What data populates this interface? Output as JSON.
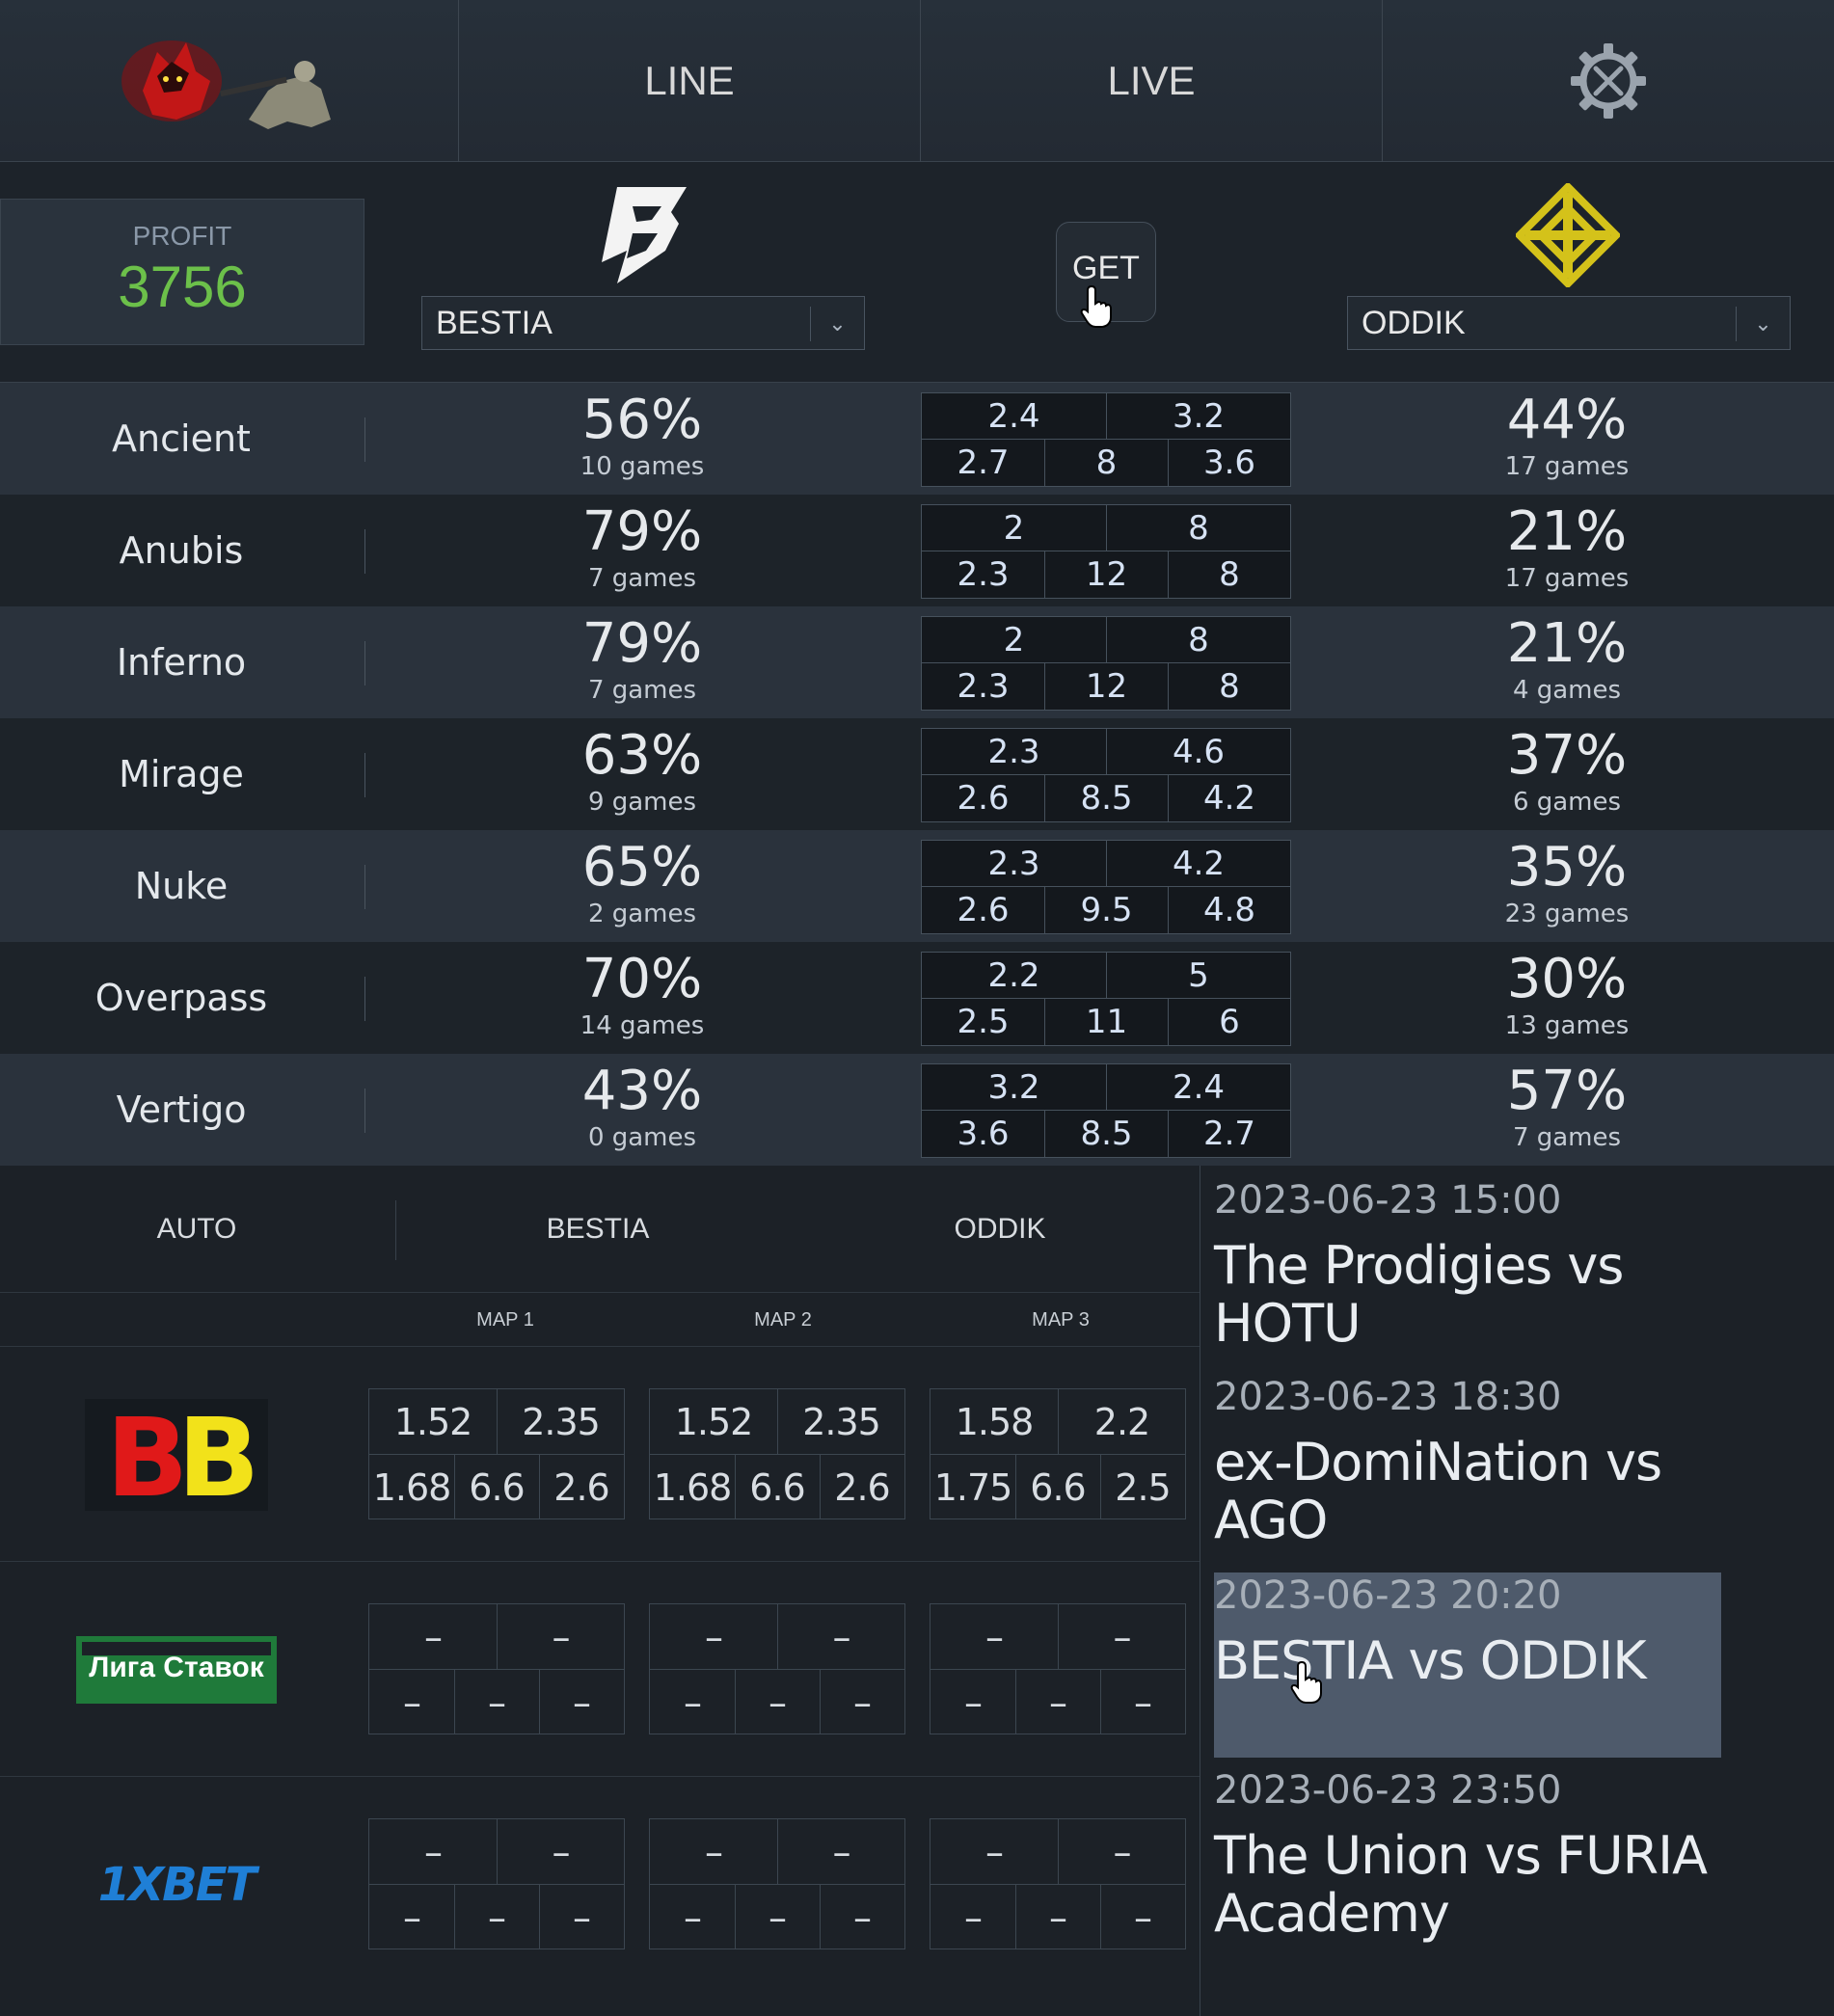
{
  "nav": {
    "tabs": [
      "LINE",
      "LIVE"
    ],
    "settings_icon": "gear-tools-icon"
  },
  "profit": {
    "label": "PROFIT",
    "value": "3756",
    "value_color": "#6cc04a"
  },
  "teams": {
    "a": {
      "name": "BESTIA",
      "logo": "bestia-logo"
    },
    "b": {
      "name": "ODDIK",
      "logo": "oddik-logo",
      "logo_color": "#d4c21a"
    }
  },
  "get_label": "GET",
  "maps": [
    {
      "name": "Ancient",
      "pct_a": "56%",
      "games_a": "10 games",
      "pct_b": "44%",
      "games_b": "17 games",
      "odds_top": [
        "2.4",
        "3.2"
      ],
      "odds_bottom": [
        "2.7",
        "8",
        "3.6"
      ]
    },
    {
      "name": "Anubis",
      "pct_a": "79%",
      "games_a": "7 games",
      "pct_b": "21%",
      "games_b": "17 games",
      "odds_top": [
        "2",
        "8"
      ],
      "odds_bottom": [
        "2.3",
        "12",
        "8"
      ]
    },
    {
      "name": "Inferno",
      "pct_a": "79%",
      "games_a": "7 games",
      "pct_b": "21%",
      "games_b": "4 games",
      "odds_top": [
        "2",
        "8"
      ],
      "odds_bottom": [
        "2.3",
        "12",
        "8"
      ]
    },
    {
      "name": "Mirage",
      "pct_a": "63%",
      "games_a": "9 games",
      "pct_b": "37%",
      "games_b": "6 games",
      "odds_top": [
        "2.3",
        "4.6"
      ],
      "odds_bottom": [
        "2.6",
        "8.5",
        "4.2"
      ]
    },
    {
      "name": "Nuke",
      "pct_a": "65%",
      "games_a": "2 games",
      "pct_b": "35%",
      "games_b": "23 games",
      "odds_top": [
        "2.3",
        "4.2"
      ],
      "odds_bottom": [
        "2.6",
        "9.5",
        "4.8"
      ]
    },
    {
      "name": "Overpass",
      "pct_a": "70%",
      "games_a": "14 games",
      "pct_b": "30%",
      "games_b": "13 games",
      "odds_top": [
        "2.2",
        "5"
      ],
      "odds_bottom": [
        "2.5",
        "11",
        "6"
      ]
    },
    {
      "name": "Vertigo",
      "pct_a": "43%",
      "games_a": "0 games",
      "pct_b": "57%",
      "games_b": "7 games",
      "odds_top": [
        "3.2",
        "2.4"
      ],
      "odds_bottom": [
        "3.6",
        "8.5",
        "2.7"
      ]
    }
  ],
  "bookmaker_section": {
    "auto_label": "AUTO",
    "team_a": "BESTIA",
    "team_b": "ODDIK",
    "map_headers": [
      "MAP 1",
      "MAP 2",
      "MAP 3"
    ],
    "rows": [
      {
        "bookmaker": "BB",
        "logo_colors": [
          "#e01919",
          "#f2e21a"
        ],
        "maps": [
          {
            "top": [
              "1.52",
              "2.35"
            ],
            "bottom": [
              "1.68",
              "6.6",
              "2.6"
            ]
          },
          {
            "top": [
              "1.52",
              "2.35"
            ],
            "bottom": [
              "1.68",
              "6.6",
              "2.6"
            ]
          },
          {
            "top": [
              "1.58",
              "2.2"
            ],
            "bottom": [
              "1.75",
              "6.6",
              "2.5"
            ]
          }
        ]
      },
      {
        "bookmaker": "Лига Ставок",
        "logo_colors": [
          "#1f7a3a",
          "#ffffff"
        ],
        "maps": [
          {
            "top": [
              "–",
              "–"
            ],
            "bottom": [
              "–",
              "–",
              "–"
            ]
          },
          {
            "top": [
              "–",
              "–"
            ],
            "bottom": [
              "–",
              "–",
              "–"
            ]
          },
          {
            "top": [
              "–",
              "–"
            ],
            "bottom": [
              "–",
              "–",
              "–"
            ]
          }
        ]
      },
      {
        "bookmaker": "1XBET",
        "logo_colors": [
          "#ffffff",
          "#1f7fd6"
        ],
        "maps": [
          {
            "top": [
              "–",
              "–"
            ],
            "bottom": [
              "–",
              "–",
              "–"
            ]
          },
          {
            "top": [
              "–",
              "–"
            ],
            "bottom": [
              "–",
              "–",
              "–"
            ]
          },
          {
            "top": [
              "–",
              "–"
            ],
            "bottom": [
              "–",
              "–",
              "–"
            ]
          }
        ]
      }
    ]
  },
  "schedule": [
    {
      "date": "2023-06-23 15:00",
      "title": "The Prodigies vs HOTU",
      "selected": false
    },
    {
      "date": "2023-06-23 18:30",
      "title": "ex-DomiNation vs AGO",
      "selected": false
    },
    {
      "date": "2023-06-23 20:20",
      "title": "BESTIA vs ODDIK",
      "selected": true
    },
    {
      "date": "2023-06-23 23:50",
      "title": "The Union vs FURIA Academy",
      "selected": false
    }
  ]
}
